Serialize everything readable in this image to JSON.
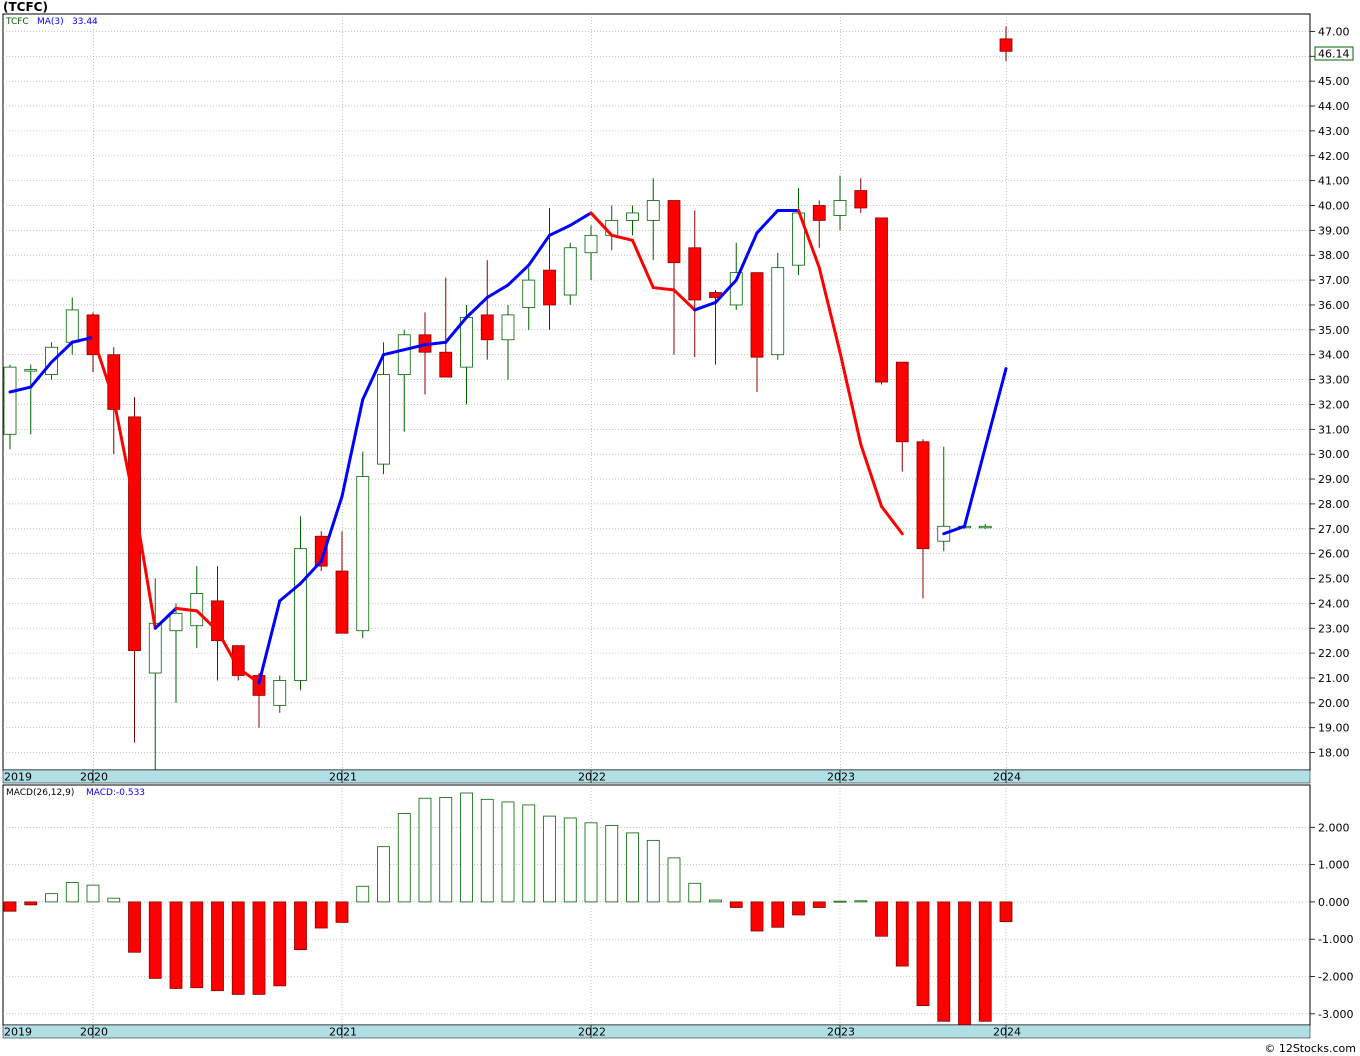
{
  "page": {
    "title": "(TCFC)",
    "watermark": "© 12Stocks.com"
  },
  "colors": {
    "up": "#006400",
    "down": "#ff0000",
    "ma_blue": "#0000ff",
    "ma_red": "#ff0000",
    "grid": "#a0a0a0",
    "axis_band": "#b0e0e6"
  },
  "chart_data": [
    {
      "type": "candlestick",
      "legend": {
        "symbol": "TCFC",
        "indicator": "MA(3)",
        "indicator_value": "33.44"
      },
      "last_price": "46.14",
      "ylim": [
        17.3,
        47.7
      ],
      "y_ticks": [
        "18.00",
        "19.00",
        "20.00",
        "21.00",
        "22.00",
        "23.00",
        "24.00",
        "25.00",
        "26.00",
        "27.00",
        "28.00",
        "29.00",
        "30.00",
        "31.00",
        "32.00",
        "33.00",
        "34.00",
        "35.00",
        "36.00",
        "37.00",
        "38.00",
        "39.00",
        "40.00",
        "41.00",
        "42.00",
        "43.00",
        "44.00",
        "45.00",
        "46.00",
        "47.00"
      ],
      "x_labels": [
        {
          "label": "2019",
          "month": 0
        },
        {
          "label": "2020",
          "month": 4
        },
        {
          "label": "2021",
          "month": 16
        },
        {
          "label": "2022",
          "month": 28
        },
        {
          "label": "2023",
          "month": 40
        },
        {
          "label": "2024",
          "month": 48
        }
      ],
      "candles": [
        {
          "o": 30.8,
          "h": 33.6,
          "l": 30.2,
          "c": 33.5
        },
        {
          "o": 33.4,
          "h": 33.6,
          "l": 30.8,
          "c": 33.4
        },
        {
          "o": 33.2,
          "h": 34.5,
          "l": 33.0,
          "c": 34.3
        },
        {
          "o": 34.5,
          "h": 36.3,
          "l": 34.0,
          "c": 35.8
        },
        {
          "o": 35.6,
          "h": 35.7,
          "l": 33.3,
          "c": 34.0
        },
        {
          "o": 34.0,
          "h": 34.3,
          "l": 30.0,
          "c": 31.8
        },
        {
          "o": 31.5,
          "h": 32.3,
          "l": 18.4,
          "c": 22.1
        },
        {
          "o": 21.2,
          "h": 25.0,
          "l": 17.3,
          "c": 23.2
        },
        {
          "o": 22.9,
          "h": 24.0,
          "l": 20.0,
          "c": 23.6
        },
        {
          "o": 23.1,
          "h": 25.5,
          "l": 22.2,
          "c": 24.4
        },
        {
          "o": 24.1,
          "h": 25.5,
          "l": 20.9,
          "c": 22.5
        },
        {
          "o": 22.3,
          "h": 22.3,
          "l": 20.9,
          "c": 21.1
        },
        {
          "o": 21.1,
          "h": 21.2,
          "l": 19.0,
          "c": 20.3
        },
        {
          "o": 19.9,
          "h": 21.1,
          "l": 19.6,
          "c": 20.9
        },
        {
          "o": 20.9,
          "h": 27.5,
          "l": 20.5,
          "c": 26.2
        },
        {
          "o": 26.7,
          "h": 26.9,
          "l": 25.3,
          "c": 25.5
        },
        {
          "o": 25.3,
          "h": 26.9,
          "l": 22.8,
          "c": 22.8
        },
        {
          "o": 22.9,
          "h": 30.1,
          "l": 22.6,
          "c": 29.1
        },
        {
          "o": 29.6,
          "h": 34.5,
          "l": 29.2,
          "c": 33.2
        },
        {
          "o": 33.2,
          "h": 35.0,
          "l": 30.9,
          "c": 34.8
        },
        {
          "o": 34.8,
          "h": 35.7,
          "l": 32.4,
          "c": 34.1
        },
        {
          "o": 34.1,
          "h": 37.1,
          "l": 33.1,
          "c": 33.1
        },
        {
          "o": 33.5,
          "h": 36.0,
          "l": 32.0,
          "c": 35.5
        },
        {
          "o": 35.6,
          "h": 37.8,
          "l": 33.8,
          "c": 34.6
        },
        {
          "o": 34.6,
          "h": 36.0,
          "l": 33.0,
          "c": 35.6
        },
        {
          "o": 35.9,
          "h": 37.5,
          "l": 35.0,
          "c": 37.0
        },
        {
          "o": 37.4,
          "h": 39.9,
          "l": 35.0,
          "c": 36.0
        },
        {
          "o": 36.4,
          "h": 38.5,
          "l": 36.0,
          "c": 38.3
        },
        {
          "o": 38.1,
          "h": 39.2,
          "l": 37.0,
          "c": 38.8
        },
        {
          "o": 38.8,
          "h": 40.0,
          "l": 38.2,
          "c": 39.4
        },
        {
          "o": 39.4,
          "h": 40.0,
          "l": 38.8,
          "c": 39.7
        },
        {
          "o": 39.4,
          "h": 41.1,
          "l": 37.8,
          "c": 40.2
        },
        {
          "o": 40.2,
          "h": 40.2,
          "l": 34.0,
          "c": 37.7
        },
        {
          "o": 38.3,
          "h": 39.8,
          "l": 33.9,
          "c": 36.2
        },
        {
          "o": 36.5,
          "h": 36.6,
          "l": 33.6,
          "c": 36.3
        },
        {
          "o": 36.0,
          "h": 38.5,
          "l": 35.8,
          "c": 37.3
        },
        {
          "o": 37.3,
          "h": 37.3,
          "l": 32.5,
          "c": 33.9
        },
        {
          "o": 34.0,
          "h": 38.1,
          "l": 33.8,
          "c": 37.5
        },
        {
          "o": 37.6,
          "h": 40.7,
          "l": 37.2,
          "c": 39.7
        },
        {
          "o": 40.0,
          "h": 40.2,
          "l": 38.3,
          "c": 39.4
        },
        {
          "o": 39.6,
          "h": 41.2,
          "l": 39.0,
          "c": 40.2
        },
        {
          "o": 40.6,
          "h": 41.1,
          "l": 39.7,
          "c": 39.9
        },
        {
          "o": 39.5,
          "h": 39.5,
          "l": 32.8,
          "c": 32.9
        },
        {
          "o": 33.7,
          "h": 33.7,
          "l": 29.3,
          "c": 30.5
        },
        {
          "o": 30.5,
          "h": 30.6,
          "l": 24.2,
          "c": 26.2
        },
        {
          "o": 26.5,
          "h": 30.3,
          "l": 26.1,
          "c": 27.1
        },
        {
          "o": 27.1,
          "h": 27.2,
          "l": 27.0,
          "c": 27.1
        },
        {
          "o": 27.1,
          "h": 27.2,
          "l": 27.0,
          "c": 27.1
        },
        {
          "o": 46.7,
          "h": 47.2,
          "l": 45.8,
          "c": 46.2
        }
      ],
      "ma": [
        32.5,
        32.7,
        33.7,
        34.5,
        34.7,
        32.2,
        28.0,
        23.0,
        23.8,
        23.7,
        22.9,
        21.4,
        20.8,
        24.1,
        24.8,
        25.7,
        28.3,
        32.2,
        34.0,
        34.2,
        34.4,
        34.5,
        35.5,
        36.3,
        36.8,
        37.6,
        38.8,
        39.2,
        39.7,
        38.8,
        38.6,
        36.7,
        36.6,
        35.8,
        36.1,
        37.0,
        38.9,
        39.8,
        39.8,
        37.5,
        34.1,
        30.4,
        27.9,
        26.8,
        27.1,
        33.44
      ],
      "ma_first_month": 0
    },
    {
      "type": "bar",
      "legend": {
        "indicator": "MACD(26,12,9)",
        "value_label": "MACD:-0.533"
      },
      "ylim": [
        -3.3,
        3.0
      ],
      "y_ticks": [
        "2.000",
        "1.000",
        "0.000",
        "-1.000",
        "-2.000",
        "-3.000"
      ],
      "y_tick_values": [
        2,
        1,
        0,
        -1,
        -2,
        -3
      ],
      "x_labels": [
        {
          "label": "2019",
          "month": 0
        },
        {
          "label": "2020",
          "month": 4
        },
        {
          "label": "2021",
          "month": 16
        },
        {
          "label": "2022",
          "month": 28
        },
        {
          "label": "2023",
          "month": 40
        },
        {
          "label": "2024",
          "month": 48
        }
      ],
      "values": [
        -0.25,
        -0.08,
        0.22,
        0.52,
        0.45,
        0.1,
        -1.35,
        -2.05,
        -2.32,
        -2.3,
        -2.38,
        -2.48,
        -2.48,
        -2.25,
        -1.28,
        -0.7,
        -0.55,
        0.42,
        1.48,
        2.37,
        2.78,
        2.8,
        2.92,
        2.75,
        2.68,
        2.6,
        2.3,
        2.25,
        2.12,
        2.05,
        1.85,
        1.65,
        1.18,
        0.5,
        0.05,
        -0.15,
        -0.78,
        -0.68,
        -0.35,
        -0.15,
        0.02,
        0.03,
        -0.92,
        -1.72,
        -2.78,
        -3.2,
        -3.3,
        -3.2,
        -0.53
      ]
    }
  ]
}
